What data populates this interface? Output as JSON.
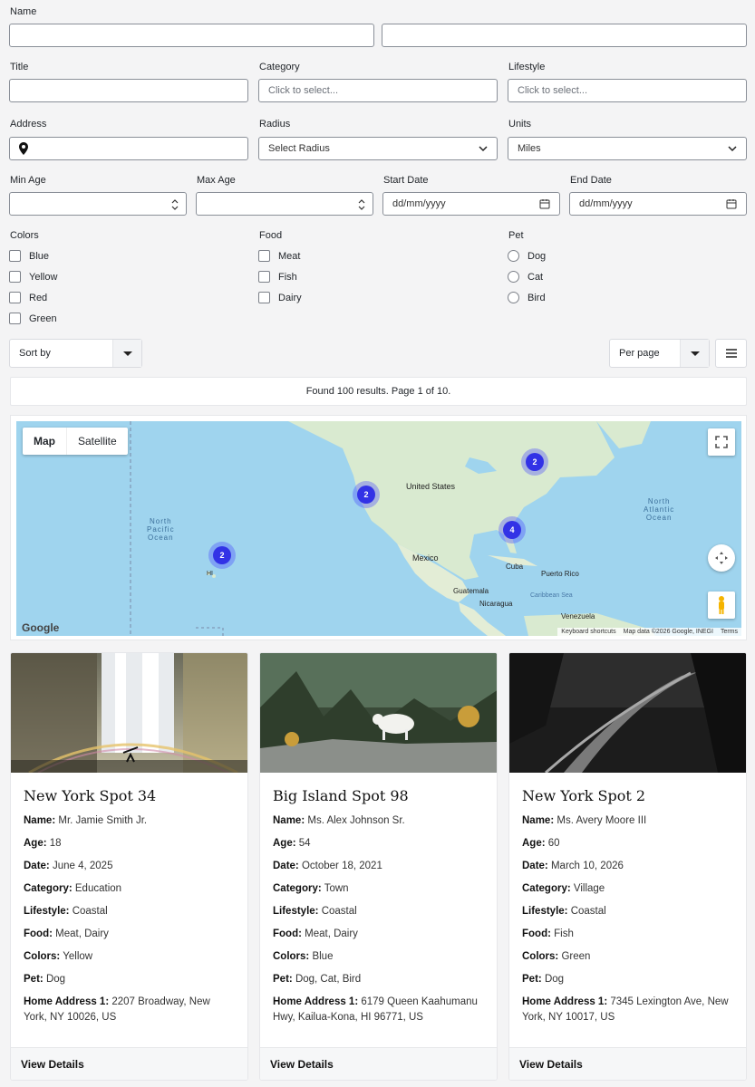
{
  "form": {
    "name_label": "Name",
    "title_label": "Title",
    "category_label": "Category",
    "category_placeholder": "Click to select...",
    "lifestyle_label": "Lifestyle",
    "lifestyle_placeholder": "Click to select...",
    "address_label": "Address",
    "radius_label": "Radius",
    "radius_value": "Select Radius",
    "units_label": "Units",
    "units_value": "Miles",
    "min_age_label": "Min Age",
    "max_age_label": "Max Age",
    "start_date_label": "Start Date",
    "start_date_placeholder": "dd/mm/yyyy",
    "end_date_label": "End Date",
    "end_date_placeholder": "dd/mm/yyyy",
    "colors_label": "Colors",
    "colors": [
      "Blue",
      "Yellow",
      "Red",
      "Green"
    ],
    "food_label": "Food",
    "food": [
      "Meat",
      "Fish",
      "Dairy"
    ],
    "pet_label": "Pet",
    "pets": [
      "Dog",
      "Cat",
      "Bird"
    ]
  },
  "toolbar": {
    "sort_label": "Sort by",
    "per_page_label": "Per page"
  },
  "results_text": "Found 100 results. Page 1 of 10.",
  "map": {
    "map_tab": "Map",
    "satellite_tab": "Satellite",
    "clusters": [
      "2",
      "2",
      "2",
      "4"
    ],
    "labels": {
      "us": "United States",
      "mexico": "Mexico",
      "cuba": "Cuba",
      "puerto_rico": "Puerto Rico",
      "guatemala": "Guatemala",
      "nicaragua": "Nicaragua",
      "caribbean": "Caribbean Sea",
      "venezuela": "Venezuela",
      "hi": "HI",
      "ne_pacific": "North\nPacific\nOcean",
      "n_atlantic": "North\nAtlantic\nOcean"
    },
    "google": "Google",
    "keyboard": "Keyboard shortcuts",
    "mapdata": "Map data ©2026 Google, INEGI",
    "terms": "Terms"
  },
  "cards": [
    {
      "title": "New York Spot 34",
      "name": "Mr. Jamie Smith Jr.",
      "age": "18",
      "date": "June 4, 2025",
      "category": "Education",
      "lifestyle": "Coastal",
      "food": "Meat, Dairy",
      "colors": "Yellow",
      "pet": "Dog",
      "address": "2207 Broadway, New York, NY 10026, US",
      "details": "View Details"
    },
    {
      "title": "Big Island Spot 98",
      "name": "Ms. Alex Johnson Sr.",
      "age": "54",
      "date": "October 18, 2021",
      "category": "Town",
      "lifestyle": "Coastal",
      "food": "Meat, Dairy",
      "colors": "Blue",
      "pet": "Dog, Cat, Bird",
      "address": "6179 Queen Kaahumanu Hwy, Kailua-Kona, HI 96771, US",
      "details": "View Details"
    },
    {
      "title": "New York Spot 2",
      "name": "Ms. Avery Moore III",
      "age": "60",
      "date": "March 10, 2026",
      "category": "Village",
      "lifestyle": "Coastal",
      "food": "Fish",
      "colors": "Green",
      "pet": "Dog",
      "address": "7345 Lexington Ave, New York, NY 10017, US",
      "details": "View Details"
    }
  ],
  "field_labels": {
    "name": "Name:",
    "age": "Age:",
    "date": "Date:",
    "category": "Category:",
    "lifestyle": "Lifestyle:",
    "food": "Food:",
    "colors": "Colors:",
    "pet": "Pet:",
    "address": "Home Address 1:"
  }
}
